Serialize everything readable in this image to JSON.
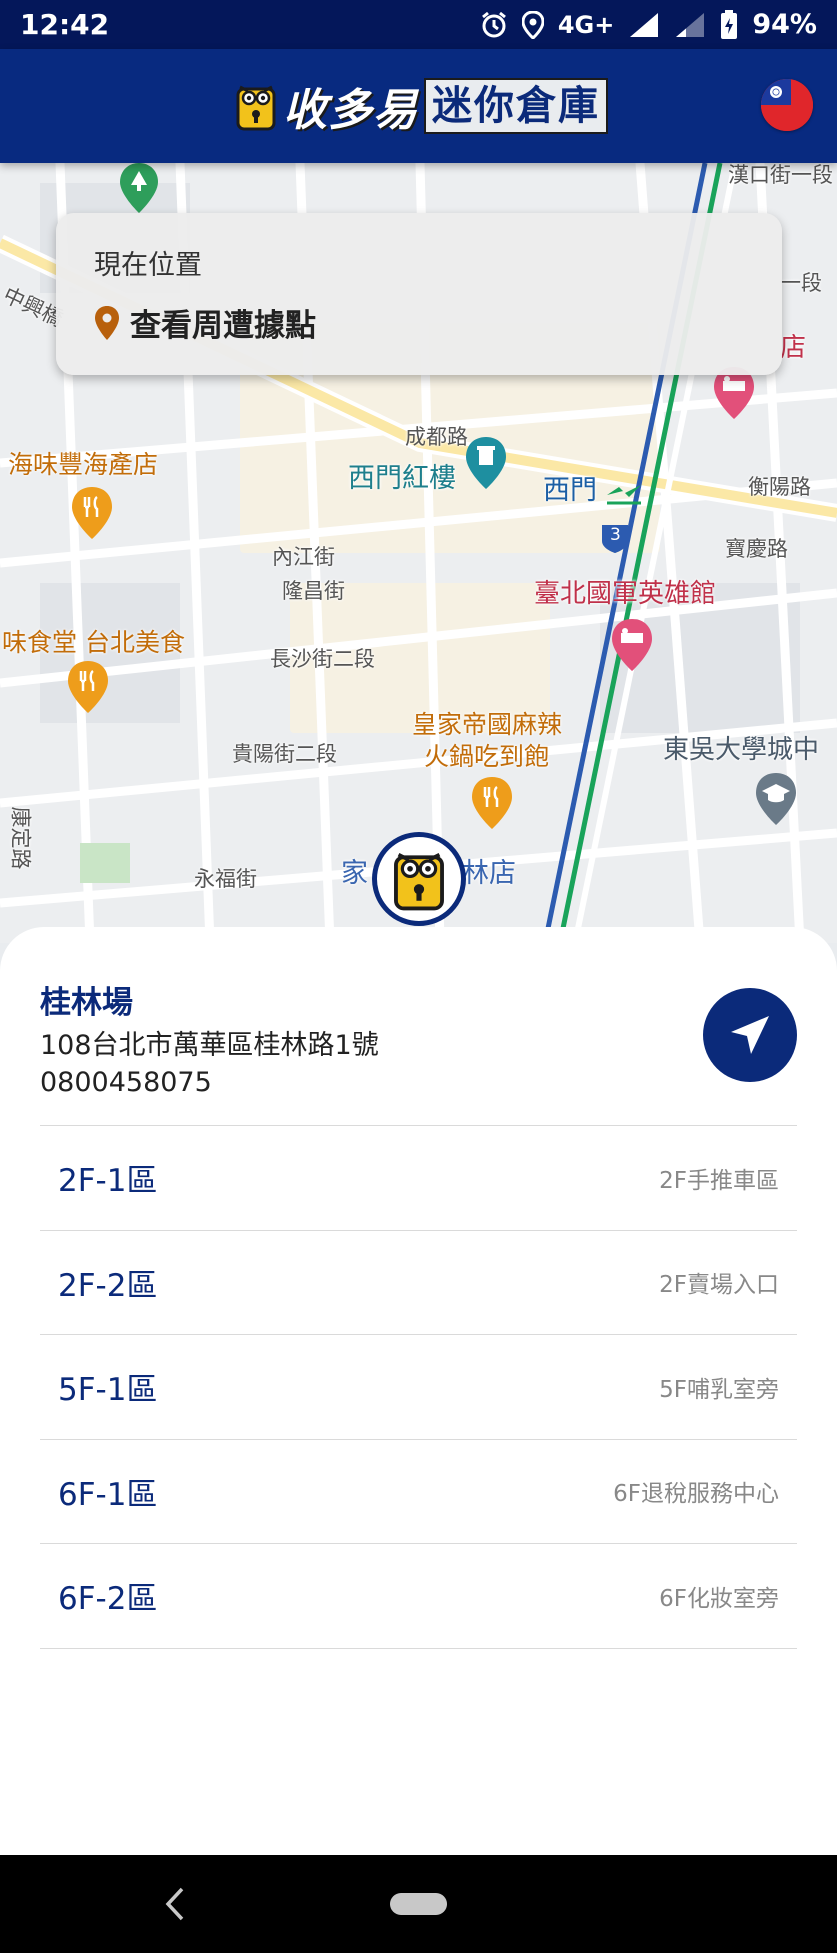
{
  "status_bar": {
    "time": "12:42",
    "network": "4G+",
    "battery": "94%"
  },
  "header": {
    "brand": "收多易",
    "subtitle": "迷你倉庫"
  },
  "location_card": {
    "title": "現在位置",
    "action_label": "查看周遭據點"
  },
  "map": {
    "labels": {
      "hankou": "漢口街一段",
      "zhongxing": "中興橋",
      "chengdu": "成都路",
      "ximen_red_house": "西門紅樓",
      "ximen_station": "西門",
      "hengyang": "衡陽路",
      "baoqing": "寶慶路",
      "neijiang": "內江街",
      "longshan": "隆昌街",
      "changsha": "長沙街二段",
      "guiyang": "貴陽街二段",
      "yongfu": "永福街",
      "kangding": "康定路",
      "seafood": "海味豐海產店",
      "taipei_food": "味食堂 台北美食",
      "hero_house": "臺北國軍英雄館",
      "hotpot_line1": "皇家帝國麻辣",
      "hotpot_line2": "火鍋吃到飽",
      "soochow": "東吳大學城中",
      "store_left": "家",
      "store_right": "林店",
      "duan": "一段",
      "dian": "店",
      "route_3": "3"
    }
  },
  "store": {
    "name": "桂林場",
    "address": "108台北市萬華區桂林路1號",
    "phone": "0800458075"
  },
  "zones": [
    {
      "name": "2F-1區",
      "desc": "2F手推車區"
    },
    {
      "name": "2F-2區",
      "desc": "2F賣場入口"
    },
    {
      "name": "5F-1區",
      "desc": "5F哺乳室旁"
    },
    {
      "name": "6F-1區",
      "desc": "6F退稅服務中心"
    },
    {
      "name": "6F-2區",
      "desc": "6F化妝室旁"
    }
  ],
  "colors": {
    "header_bg": "#082a80",
    "status_bg": "#04175a",
    "brand_blue": "#0b2a7a",
    "accent_yellow": "#f2c21b"
  },
  "icons": {
    "nav": "navigation-arrow-icon",
    "pin": "location-pin-icon",
    "flag": "taiwan-flag-icon"
  }
}
